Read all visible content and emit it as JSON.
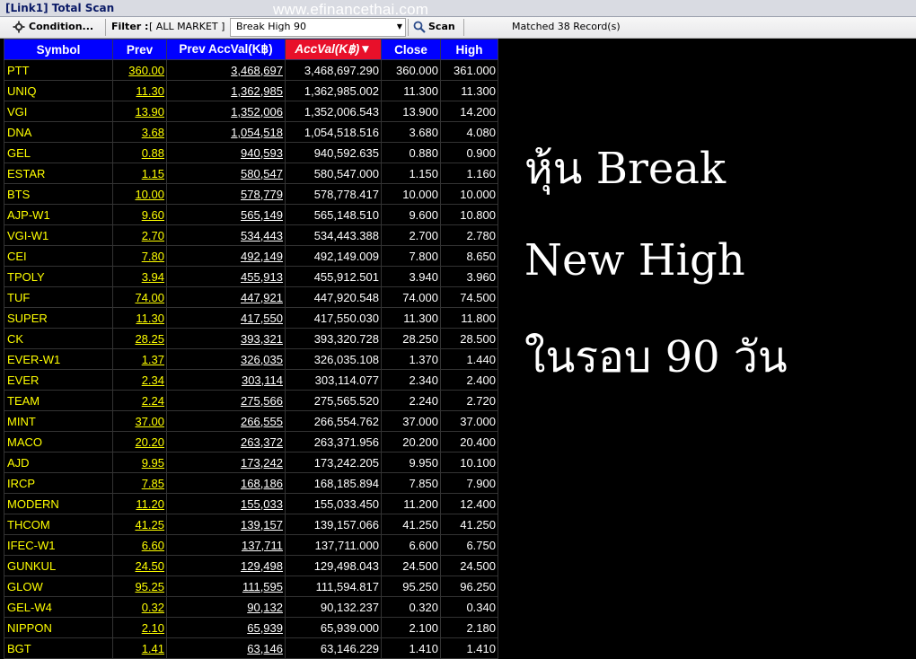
{
  "window": {
    "title": "[Link1] Total Scan"
  },
  "watermark": "www.efinancethai.com",
  "toolbar": {
    "condition_label": "Condition...",
    "filter_label": "Filter :",
    "market_value": "[ ALL MARKET ]",
    "scan_selected": "Break High 90",
    "scan_label": "Scan",
    "matched_text": "Matched 38 Record(s)"
  },
  "table": {
    "columns": [
      "Symbol",
      "Prev",
      "Prev AccVal(K฿)",
      "AccVal(K฿)",
      "Close",
      "High"
    ],
    "sort_indicator": "▼",
    "rows": [
      [
        "PTT",
        "360.00",
        "3,468,697",
        "3,468,697.290",
        "360.000",
        "361.000"
      ],
      [
        "UNIQ",
        "11.30",
        "1,362,985",
        "1,362,985.002",
        "11.300",
        "11.300"
      ],
      [
        "VGI",
        "13.90",
        "1,352,006",
        "1,352,006.543",
        "13.900",
        "14.200"
      ],
      [
        "DNA",
        "3.68",
        "1,054,518",
        "1,054,518.516",
        "3.680",
        "4.080"
      ],
      [
        "GEL",
        "0.88",
        "940,593",
        "940,592.635",
        "0.880",
        "0.900"
      ],
      [
        "ESTAR",
        "1.15",
        "580,547",
        "580,547.000",
        "1.150",
        "1.160"
      ],
      [
        "BTS",
        "10.00",
        "578,779",
        "578,778.417",
        "10.000",
        "10.000"
      ],
      [
        "AJP-W1",
        "9.60",
        "565,149",
        "565,148.510",
        "9.600",
        "10.800"
      ],
      [
        "VGI-W1",
        "2.70",
        "534,443",
        "534,443.388",
        "2.700",
        "2.780"
      ],
      [
        "CEI",
        "7.80",
        "492,149",
        "492,149.009",
        "7.800",
        "8.650"
      ],
      [
        "TPOLY",
        "3.94",
        "455,913",
        "455,912.501",
        "3.940",
        "3.960"
      ],
      [
        "TUF",
        "74.00",
        "447,921",
        "447,920.548",
        "74.000",
        "74.500"
      ],
      [
        "SUPER",
        "11.30",
        "417,550",
        "417,550.030",
        "11.300",
        "11.800"
      ],
      [
        "CK",
        "28.25",
        "393,321",
        "393,320.728",
        "28.250",
        "28.500"
      ],
      [
        "EVER-W1",
        "1.37",
        "326,035",
        "326,035.108",
        "1.370",
        "1.440"
      ],
      [
        "EVER",
        "2.34",
        "303,114",
        "303,114.077",
        "2.340",
        "2.400"
      ],
      [
        "TEAM",
        "2.24",
        "275,566",
        "275,565.520",
        "2.240",
        "2.720"
      ],
      [
        "MINT",
        "37.00",
        "266,555",
        "266,554.762",
        "37.000",
        "37.000"
      ],
      [
        "MACO",
        "20.20",
        "263,372",
        "263,371.956",
        "20.200",
        "20.400"
      ],
      [
        "AJD",
        "9.95",
        "173,242",
        "173,242.205",
        "9.950",
        "10.100"
      ],
      [
        "IRCP",
        "7.85",
        "168,186",
        "168,185.894",
        "7.850",
        "7.900"
      ],
      [
        "MODERN",
        "11.20",
        "155,033",
        "155,033.450",
        "11.200",
        "12.400"
      ],
      [
        "THCOM",
        "41.25",
        "139,157",
        "139,157.066",
        "41.250",
        "41.250"
      ],
      [
        "IFEC-W1",
        "6.60",
        "137,711",
        "137,711.000",
        "6.600",
        "6.750"
      ],
      [
        "GUNKUL",
        "24.50",
        "129,498",
        "129,498.043",
        "24.500",
        "24.500"
      ],
      [
        "GLOW",
        "95.25",
        "111,595",
        "111,594.817",
        "95.250",
        "96.250"
      ],
      [
        "GEL-W4",
        "0.32",
        "90,132",
        "90,132.237",
        "0.320",
        "0.340"
      ],
      [
        "NIPPON",
        "2.10",
        "65,939",
        "65,939.000",
        "2.100",
        "2.180"
      ],
      [
        "BGT",
        "1.41",
        "63,146",
        "63,146.229",
        "1.410",
        "1.410"
      ]
    ]
  },
  "overlay": {
    "line1": "หุ้น Break",
    "line2": "New High",
    "line3": "ในรอบ 90 วัน"
  },
  "colors": {
    "header_bg": "#0000ff",
    "sorted_header_bg": "#e8102a",
    "symbol_text": "#ffff00",
    "value_text": "#ffffff",
    "background": "#000000"
  },
  "icons": {
    "condition": "gear-icon",
    "scan": "magnifier-icon",
    "dropdown": "chevron-down-icon"
  }
}
